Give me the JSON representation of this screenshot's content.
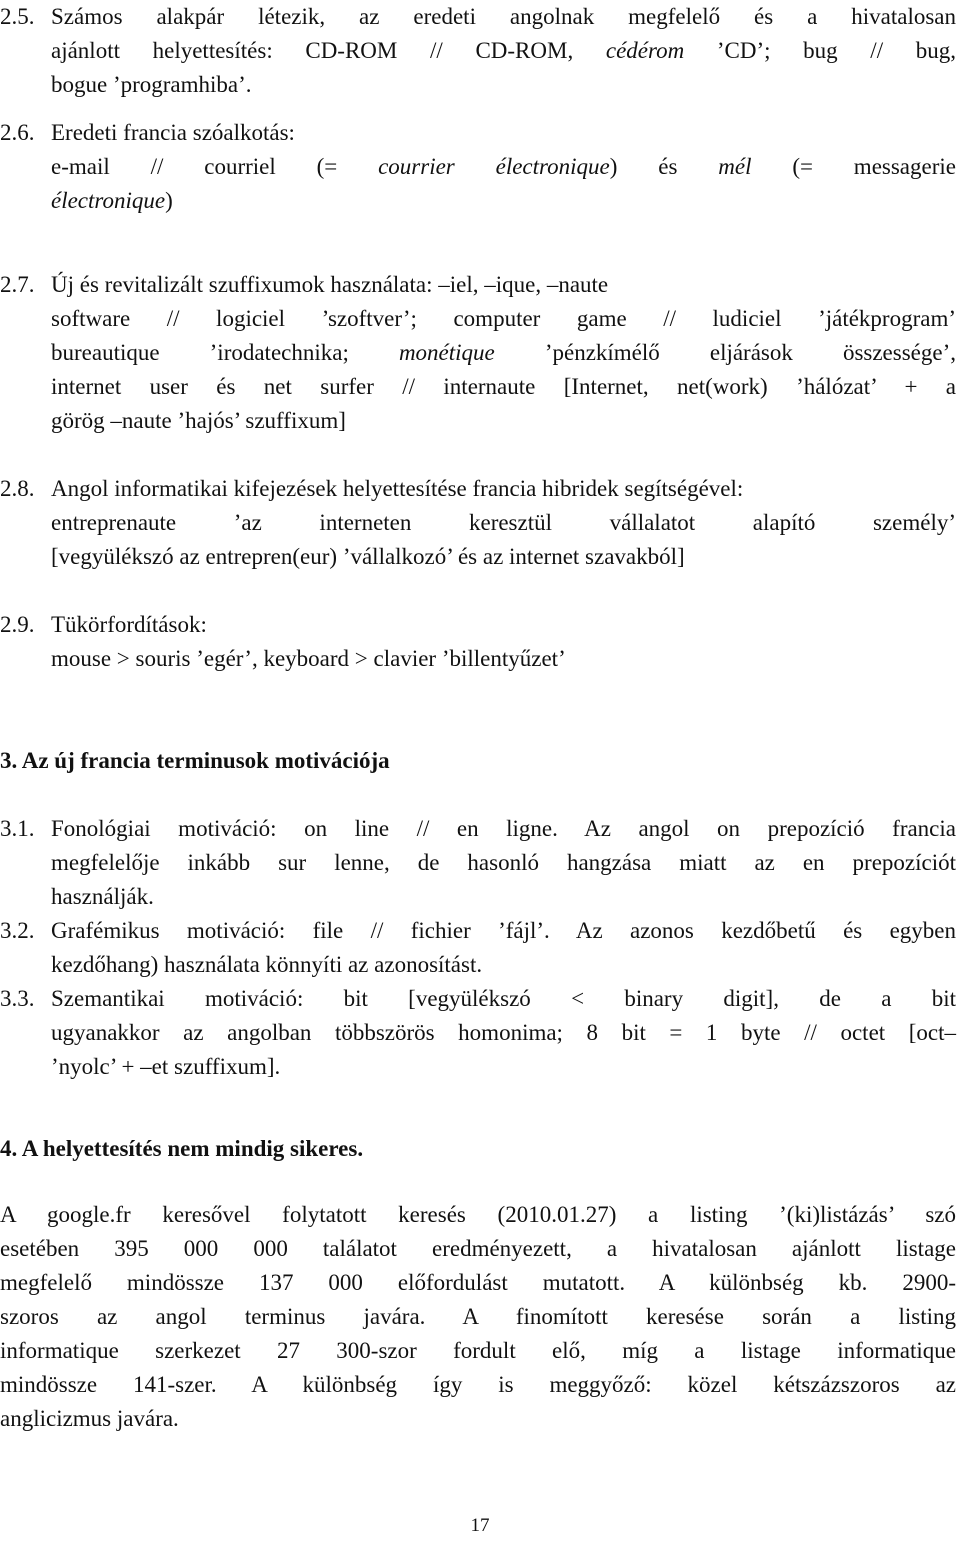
{
  "sections": {
    "s2_5": {
      "number": "2.5.",
      "line1": "Számos alakpár létezik, az eredeti angolnak megfelelő és a hivatalosan",
      "line2_a": "ajánlott helyettesítés: CD-ROM // CD-ROM, ",
      "line2_italic": "cédérom",
      "line2_b": " ’CD’; bug // bug,",
      "line3": "bogue ’programhiba’."
    },
    "s2_6": {
      "number": "2.6.",
      "title": "Eredeti francia szóalkotás:",
      "line2_a": "e-mail // courriel (= ",
      "line2_italic1": "courrier électronique",
      "line2_b": ") és ",
      "line2_italic2": "mél",
      "line2_c": " (= messagerie",
      "line3_italic": "électronique",
      "line3_b": ")"
    },
    "s2_7": {
      "number": "2.7.",
      "title": "Új és revitalizált szuffixumok használata: –iel, –ique, –naute",
      "line2": "software // logiciel ’szoftver’; computer game // ludiciel ’játékprogram’",
      "line3_a": "bureautique ’irodatechnika; ",
      "line3_italic": "monétique",
      "line3_b": " ’pénzkímélő eljárások összessége’,",
      "line4": "internet user és net surfer // internaute [Internet, net(work) ’hálózat’ + a",
      "line5": "görög –naute ’hajós’ szuffixum]"
    },
    "s2_8": {
      "number": "2.8.",
      "title": "Angol informatikai kifejezések helyettesítése francia hibridek segítségével:",
      "line2": "entreprenaute ’az interneten keresztül vállalatot alapító személy’",
      "line3": "[vegyülékszó az entrepren(eur) ’vállalkozó’ és az internet szavakból]"
    },
    "s2_9": {
      "number": "2.9.",
      "title": "Tükörfordítások:",
      "line2": "mouse > souris ’egér’, keyboard > clavier ’billentyűzet’"
    },
    "h3": "3. Az új francia terminusok motivációja",
    "s3_1": {
      "number": "3.1.",
      "line1": "Fonológiai motiváció: on line // en ligne. Az angol on prepozíció francia",
      "line2": "megfelelője inkább sur lenne, de hasonló hangzása miatt az en prepozíciót",
      "line3": "használják."
    },
    "s3_2": {
      "number": "3.2.",
      "line1": "Grafémikus motiváció: file // fichier ’fájl’. Az azonos kezdőbetű és egyben",
      "line2": "kezdőhang) használata könnyíti az azonosítást."
    },
    "s3_3": {
      "number": "3.3.",
      "line1": "Szemantikai motiváció: bit [vegyülékszó < binary digit], de a bit",
      "line2": "ugyanakkor az angolban többszörös homonima; 8 bit = 1 byte // octet [oct–",
      "line3": "’nyolc’ + –et szuffixum]."
    },
    "h4": "4. A helyettesítés nem mindig sikeres.",
    "para": [
      "A google.fr keresővel folytatott keresés (2010.01.27) a listing ’(ki)listázás’ szó",
      "esetében 395 000 000 találatot eredményezett, a hivatalosan ajánlott listage",
      "megfelelő mindössze 137 000 előfordulást mutatott. A különbség kb. 2900-",
      "szoros az angol terminus javára. A finomított keresése során a listing",
      "informatique szerkezet 27 300-szor fordult elő, míg a listage informatique",
      "mindössze 141-szer. A különbség így is meggyőző: közel kétszázszoros az",
      "anglicizmus javára."
    ],
    "page_number": "17"
  }
}
